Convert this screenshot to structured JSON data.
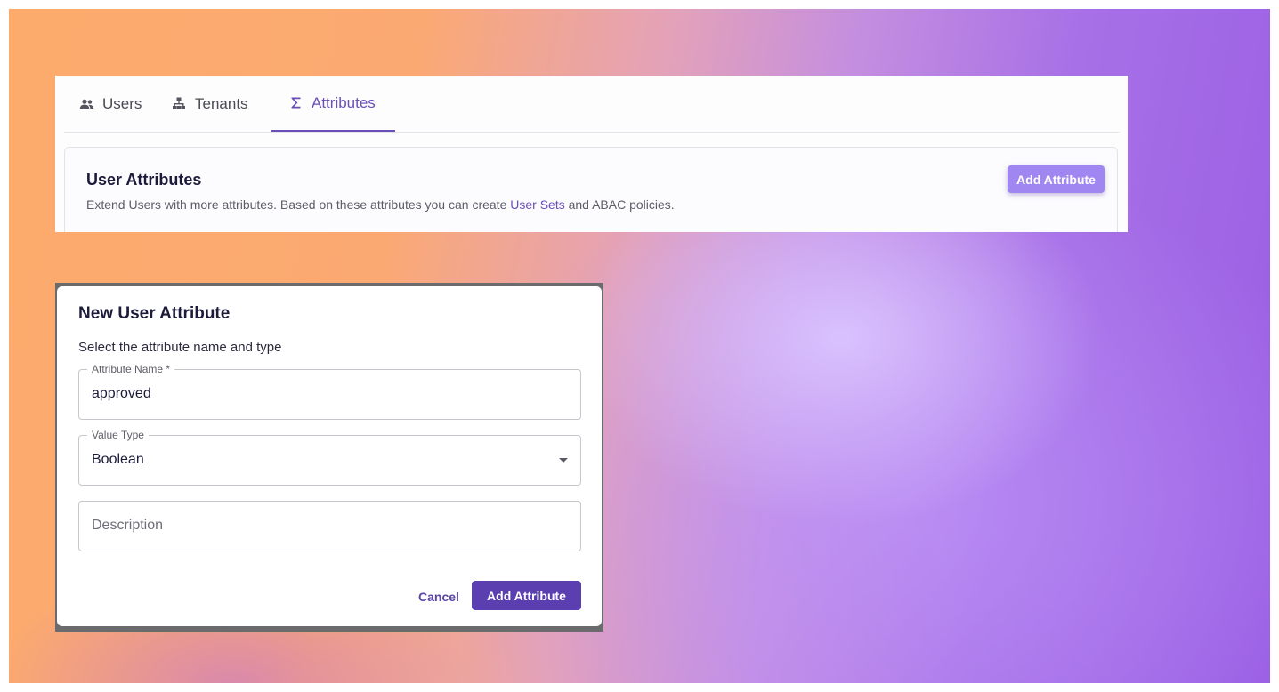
{
  "tabs": [
    {
      "label": "Users",
      "icon": "users-icon"
    },
    {
      "label": "Tenants",
      "icon": "tenants-hierarchy-icon"
    },
    {
      "label": "Attributes",
      "icon": "sigma-icon",
      "active": true
    }
  ],
  "attributes_section": {
    "title": "User Attributes",
    "description_before": "Extend Users with more attributes. Based on these attributes you can create ",
    "description_link": "User Sets",
    "description_after": " and ABAC policies.",
    "add_button": "Add Attribute"
  },
  "dialog": {
    "title": "New User Attribute",
    "subtitle": "Select the attribute name and type",
    "fields": {
      "name": {
        "label": "Attribute Name *",
        "value": "approved"
      },
      "type": {
        "label": "Value Type",
        "value": "Boolean"
      },
      "description": {
        "placeholder": "Description",
        "value": ""
      }
    },
    "cancel_button": "Cancel",
    "submit_button": "Add Attribute"
  },
  "colors": {
    "accent": "#6a4fb8",
    "primary_button": "#5b3fb0",
    "secondary_button": "#9f86f0",
    "text_dark": "#1d1b3a"
  }
}
